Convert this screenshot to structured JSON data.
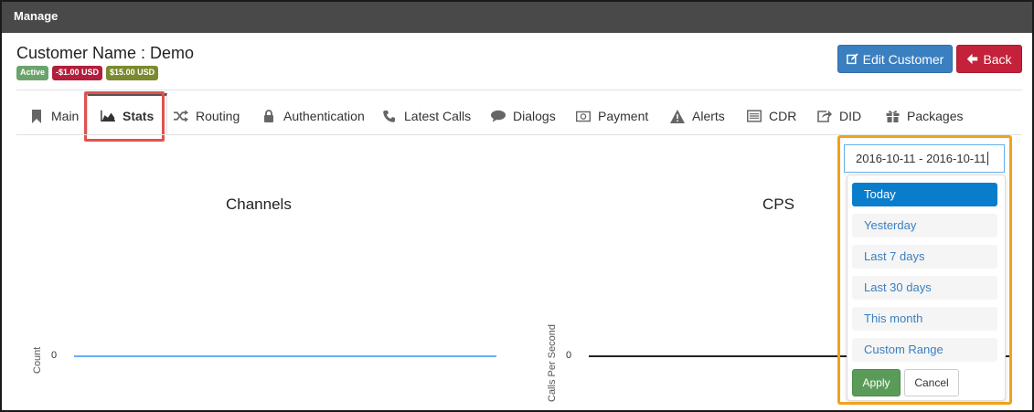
{
  "topbar": {
    "title": "Manage"
  },
  "customer": {
    "title": "Customer Name : Demo",
    "badges": {
      "status": "Active",
      "balance": "-$1.00 USD",
      "credit": "$15.00 USD"
    }
  },
  "actions": {
    "edit_label": "Edit Customer",
    "back_label": "Back"
  },
  "tabs": {
    "main": "Main",
    "stats": "Stats",
    "routing": "Routing",
    "authentication": "Authentication",
    "latest_calls": "Latest Calls",
    "dialogs": "Dialogs",
    "payment": "Payment",
    "alerts": "Alerts",
    "cdr": "CDR",
    "did": "DID",
    "packages": "Packages"
  },
  "charts": {
    "channels": {
      "title": "Channels",
      "ylabel": "Count",
      "tick": "0"
    },
    "cps": {
      "title": "CPS",
      "ylabel": "Calls Per Second",
      "tick": "0"
    }
  },
  "daterange": {
    "value": "2016-10-11 - 2016-10-11",
    "ranges": {
      "today": "Today",
      "yesterday": "Yesterday",
      "last7": "Last 7 days",
      "last30": "Last 30 days",
      "this_month": "This month",
      "custom": "Custom Range"
    },
    "apply_label": "Apply",
    "cancel_label": "Cancel"
  },
  "colors": {
    "accent": "#0a7ccc",
    "highlight_tab": "#e0524f",
    "highlight_picker": "#f0a21a",
    "channels_line": "#66aef5"
  }
}
